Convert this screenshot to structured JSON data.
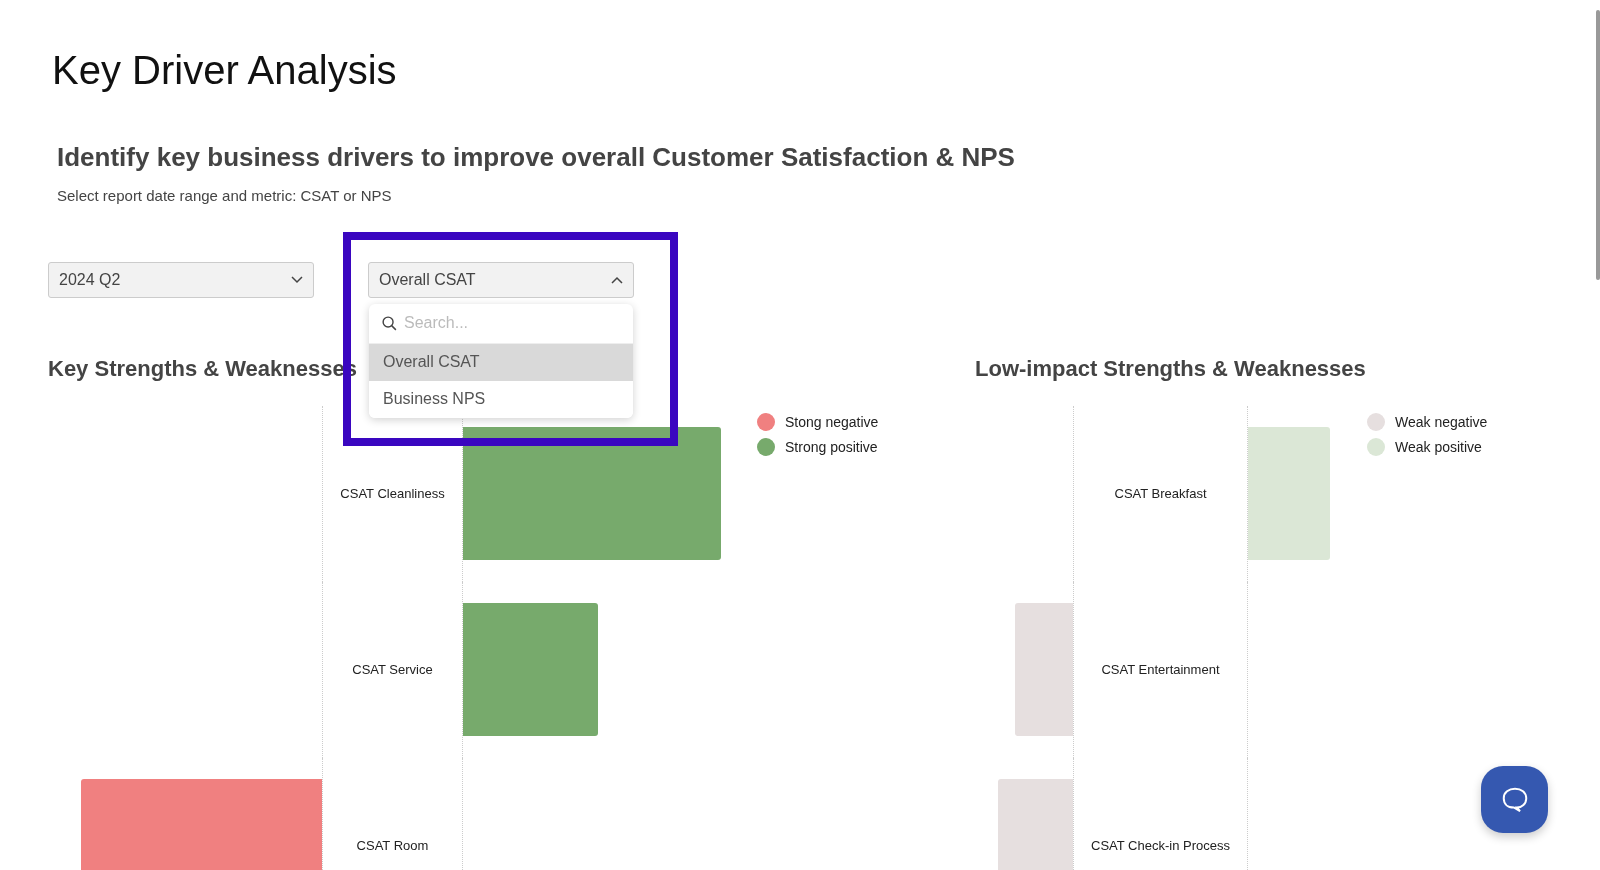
{
  "page_title": "Key Driver Analysis",
  "heading": "Identify key business drivers to improve overall Customer Satisfaction & NPS",
  "caption": "Select report date range and metric: CSAT or NPS",
  "date_select": {
    "value": "2024 Q2",
    "expanded": false
  },
  "metric_select": {
    "value": "Overall CSAT",
    "expanded": true,
    "highlighted": true,
    "search_placeholder": "Search...",
    "options": [
      {
        "label": "Overall CSAT",
        "selected": true
      },
      {
        "label": "Business NPS",
        "selected": false
      }
    ]
  },
  "charts": [
    {
      "title": "Key Strengths & Weaknesses",
      "legend": [
        {
          "kind": "negative",
          "label": "Stong negative",
          "color": "#f08080"
        },
        {
          "kind": "positive",
          "label": "Strong positive",
          "color": "#77aa6c"
        }
      ],
      "rows": [
        {
          "label": "CSAT Cleanliness",
          "kind": "positive"
        },
        {
          "label": "CSAT Service",
          "kind": "positive"
        },
        {
          "label": "CSAT Room",
          "kind": "negative"
        }
      ]
    },
    {
      "title": "Low-impact Strengths & Weaknesses",
      "legend": [
        {
          "kind": "negative",
          "label": "Weak negative",
          "color": "#e6dfdf"
        },
        {
          "kind": "positive",
          "label": "Weak positive",
          "color": "#dbe7d6"
        }
      ],
      "rows": [
        {
          "label": "CSAT Breakfast",
          "kind": "positive"
        },
        {
          "label": "CSAT Entertainment",
          "kind": "negative"
        },
        {
          "label": "CSAT Check-in Process",
          "kind": "negative"
        }
      ]
    }
  ]
}
